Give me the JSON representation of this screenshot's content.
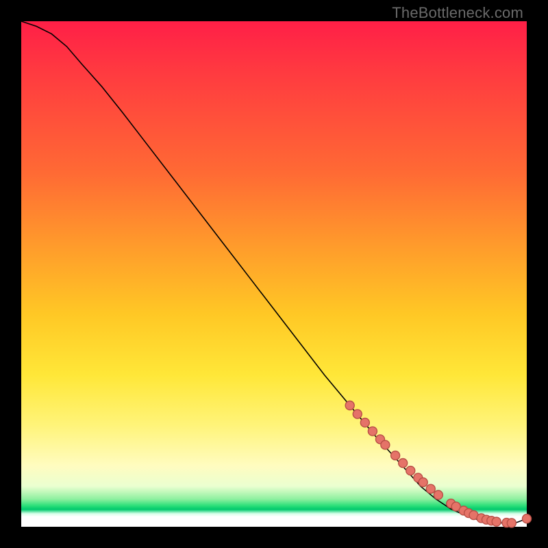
{
  "watermark": "TheBottleneck.com",
  "chart_data": {
    "type": "line",
    "title": "",
    "xlabel": "",
    "ylabel": "",
    "xlim": [
      0,
      100
    ],
    "ylim": [
      0,
      100
    ],
    "grid": false,
    "legend": false,
    "curve": {
      "name": "bottleneck-curve",
      "x": [
        0,
        3,
        6,
        9,
        12,
        16,
        20,
        25,
        30,
        35,
        40,
        45,
        50,
        55,
        60,
        65,
        70,
        75,
        79,
        82,
        85,
        88,
        90,
        92,
        94,
        96,
        98,
        100
      ],
      "y": [
        100,
        99,
        97.5,
        95,
        91.5,
        87,
        82,
        75.5,
        69,
        62.5,
        56,
        49.5,
        43,
        36.5,
        30,
        24,
        18,
        12.5,
        8,
        5.5,
        3.5,
        2.2,
        1.5,
        1.05,
        0.8,
        0.7,
        0.85,
        1.6
      ]
    },
    "markers": {
      "name": "data-points",
      "x": [
        65,
        66.5,
        68,
        69.5,
        71,
        72,
        74,
        75.5,
        77,
        78.5,
        79.5,
        81,
        82.5,
        85,
        86,
        87.5,
        88.5,
        89.5,
        91,
        92,
        93,
        94,
        96,
        97,
        100
      ],
      "y": [
        24,
        22.3,
        20.6,
        18.9,
        17.3,
        16.2,
        14.1,
        12.6,
        11.1,
        9.7,
        8.8,
        7.5,
        6.3,
        4.6,
        4.0,
        3.2,
        2.7,
        2.3,
        1.7,
        1.4,
        1.2,
        1.0,
        0.8,
        0.75,
        1.6
      ]
    }
  },
  "colors": {
    "curve": "#000000",
    "marker_fill": "#e57368",
    "marker_stroke": "#b84f46"
  }
}
